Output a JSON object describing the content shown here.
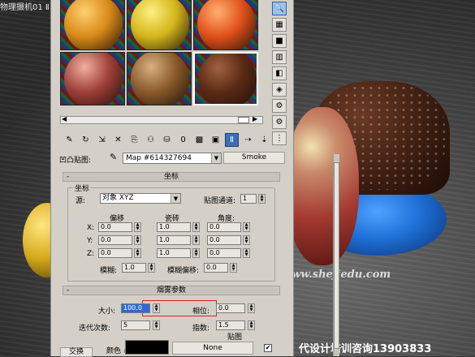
{
  "viewport": {
    "title": "物理摄机01 Ⅱ",
    "watermark": "www.shejiedu.com",
    "promo": "代设计培训咨询13903833"
  },
  "slots": [
    {
      "sphere_color": "#d88a18",
      "hilite": "#ffd070",
      "selected": false
    },
    {
      "sphere_color": "#d4b61a",
      "hilite": "#fff080",
      "selected": false
    },
    {
      "sphere_color": "#e0501a",
      "hilite": "#ffb070",
      "selected": false
    },
    {
      "sphere_color": "#a0403a",
      "hilite": "#f0b0a0",
      "selected": false
    },
    {
      "sphere_color": "#8a5a2a",
      "hilite": "#d8b080",
      "selected": false
    },
    {
      "sphere_color": "#5a2a15",
      "hilite": "#a06040",
      "selected": true
    }
  ],
  "side_tools": [
    {
      "icon": "magnifier-icon",
      "glyph": "🔍",
      "active": true
    },
    {
      "icon": "checker-icon",
      "glyph": "▦",
      "active": false
    },
    {
      "icon": "sphere-icon",
      "glyph": "■",
      "active": false
    },
    {
      "icon": "backlight-icon",
      "glyph": "▥",
      "active": false
    },
    {
      "icon": "sample-uv-icon",
      "glyph": "◧",
      "active": false
    },
    {
      "icon": "video-color-icon",
      "glyph": "◈",
      "active": false
    },
    {
      "icon": "make-preview-icon",
      "glyph": "⚙",
      "active": false
    },
    {
      "icon": "options-icon",
      "glyph": "⚙",
      "active": false
    },
    {
      "icon": "select-by-material-icon",
      "glyph": "⋮",
      "active": false
    }
  ],
  "toolbar": [
    {
      "icon": "get-material-icon",
      "glyph": "✎"
    },
    {
      "icon": "put-to-scene-icon",
      "glyph": "↻"
    },
    {
      "icon": "assign-material-icon",
      "glyph": "⇲"
    },
    {
      "icon": "delete-icon",
      "glyph": "✕"
    },
    {
      "icon": "make-copy-icon",
      "glyph": "⎘"
    },
    {
      "icon": "make-unique-icon",
      "glyph": "⚇"
    },
    {
      "icon": "put-to-library-icon",
      "glyph": "⛁"
    },
    {
      "icon": "material-id-icon",
      "glyph": "0"
    },
    {
      "icon": "show-map-icon",
      "glyph": "▩"
    },
    {
      "icon": "show-end-result-icon",
      "glyph": "▣"
    },
    {
      "icon": "go-to-parent-icon",
      "glyph": "Ⅱ"
    },
    {
      "icon": "go-forward-icon",
      "glyph": "⇢"
    },
    {
      "icon": "navigator-icon",
      "glyph": "⇣"
    }
  ],
  "map_row": {
    "label": "凹凸贴图:",
    "map_name": "Map #614327694",
    "map_type": "Smoke"
  },
  "coords": {
    "rollout_title": "坐标",
    "group_title": "坐标",
    "source_label": "源:",
    "source_value": "对象 XYZ",
    "map_channel_label": "贴图通道:",
    "map_channel_value": "1",
    "col_offset": "偏移",
    "col_tiling": "瓷砖",
    "col_angle": "角度:",
    "axes": [
      {
        "axis": "X:",
        "offset": "0.0",
        "tiling": "1.0",
        "angle": "0.0"
      },
      {
        "axis": "Y:",
        "offset": "0.0",
        "tiling": "1.0",
        "angle": "0.0"
      },
      {
        "axis": "Z:",
        "offset": "0.0",
        "tiling": "1.0",
        "angle": "0.0"
      }
    ],
    "blur_label": "模糊:",
    "blur_value": "1.0",
    "blur_offset_label": "模糊偏移:",
    "blur_offset_value": "0.0"
  },
  "smoke": {
    "rollout_title": "烟雾参数",
    "size_label": "大小:",
    "size_value": "100.0",
    "phase_label": "相位:",
    "phase_value": "0.0",
    "iterations_label": "迭代次数:",
    "iterations_value": "5",
    "exponent_label": "指数:",
    "exponent_value": "1.5",
    "maps_label": "贴图",
    "swap_label": "交换",
    "color1_label": "颜色 #1",
    "none_label": "None",
    "check_glyph": "✔"
  }
}
